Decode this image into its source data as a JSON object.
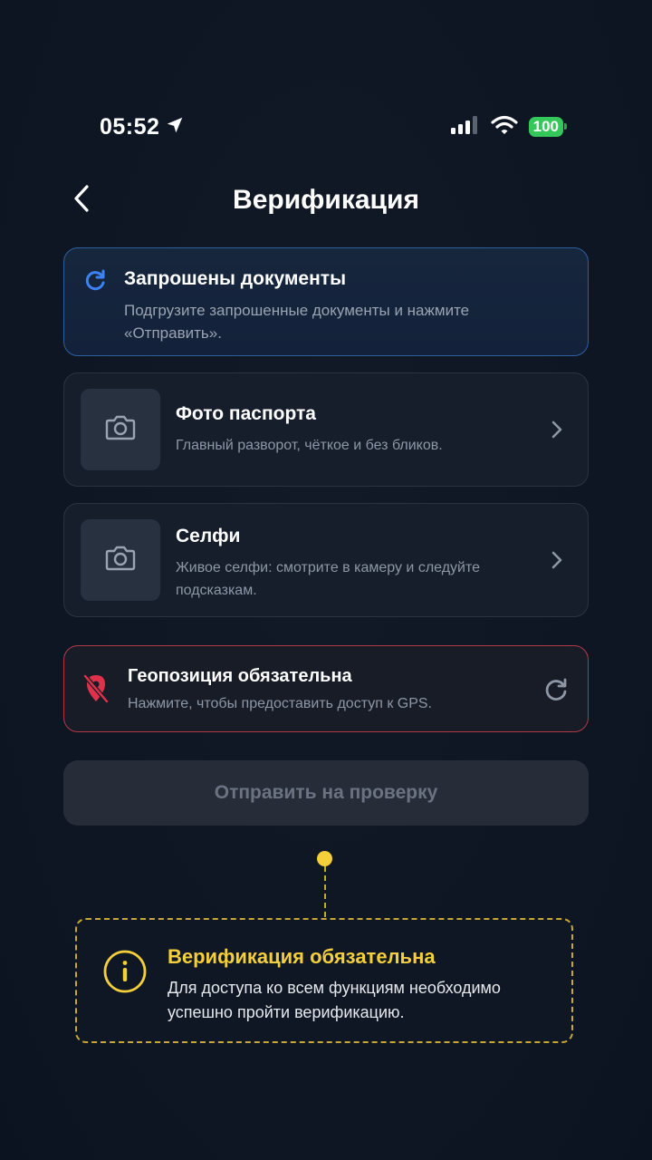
{
  "status_bar": {
    "time": "05:52",
    "battery": "100"
  },
  "header": {
    "title": "Верификация"
  },
  "info_card": {
    "title": "Запрошены документы",
    "text": "Подгрузите запрошенные документы и нажмите «Отправить»."
  },
  "documents": [
    {
      "title": "Фото паспорта",
      "text": "Главный разворот, чёткое и без бликов."
    },
    {
      "title": "Селфи",
      "text": "Живое селфи: смотрите в камеру и следуйте подсказкам."
    }
  ],
  "geo_card": {
    "title": "Геопозиция обязательна",
    "text": "Нажмите, чтобы предоставить доступ к GPS."
  },
  "submit": {
    "label": "Отправить на проверку",
    "disabled": true
  },
  "tooltip": {
    "title": "Верификация обязательна",
    "text": "Для доступа ко всем функциям необходимо успешно пройти верификацию."
  },
  "colors": {
    "accent_blue": "#3b82f6",
    "error_red": "#e0314b",
    "warning_yellow": "#f5cf3a",
    "battery_green": "#34c759"
  },
  "icons": {
    "location": "location-arrow-icon",
    "signal": "cellular-signal-icon",
    "wifi": "wifi-icon",
    "back": "chevron-left-icon",
    "info_card": "refresh-icon",
    "document": "camera-icon",
    "chevron": "chevron-right-icon",
    "geo": "location-off-icon",
    "geo_refresh": "refresh-icon",
    "tooltip": "info-icon"
  }
}
